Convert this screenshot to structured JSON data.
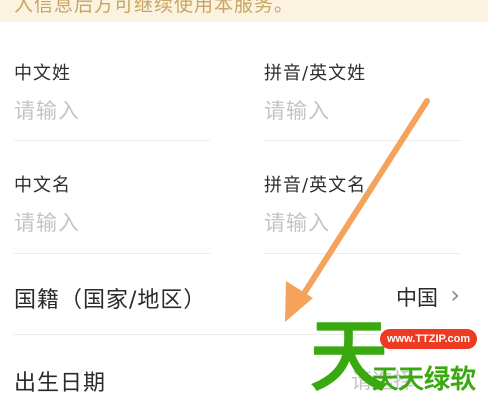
{
  "notice": {
    "text": "入信息后方可继续使用本服务。"
  },
  "form": {
    "surname_cn": {
      "label": "中文姓",
      "placeholder": "请输入"
    },
    "surname_py": {
      "label": "拼音/英文姓",
      "placeholder": "请输入"
    },
    "given_cn": {
      "label": "中文名",
      "placeholder": "请输入"
    },
    "given_py": {
      "label": "拼音/英文名",
      "placeholder": "请输入"
    },
    "nationality": {
      "label": "国籍（国家/地区）",
      "value": "中国"
    },
    "birth": {
      "label": "出生日期",
      "placeholder": "请选择"
    }
  },
  "icons": {
    "chevron": "chevron-right-icon",
    "arrow": "annotation-arrow"
  },
  "colors": {
    "arrow": "#f5a25d",
    "watermark_green": "#3aa810",
    "watermark_red": "#ee3a22",
    "notice_bg": "#fbf3df"
  },
  "watermark": {
    "char": "天",
    "url": "www.TTZIP.com",
    "name": "天天绿软"
  }
}
